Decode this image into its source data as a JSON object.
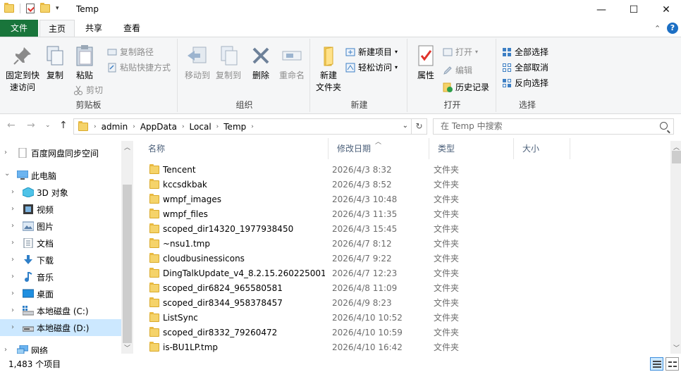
{
  "window": {
    "title": "Temp",
    "min_glyph": "—",
    "max_glyph": "☐",
    "close_glyph": "✕"
  },
  "tabs": {
    "file": "文件",
    "home": "主页",
    "share": "共享",
    "view": "查看"
  },
  "ribbon": {
    "clipboard": {
      "label": "剪贴板",
      "pin": "固定到快\n速访问",
      "copy": "复制",
      "paste": "粘贴",
      "copy_path": "复制路径",
      "paste_shortcut": "粘贴快捷方式",
      "cut": "剪切"
    },
    "organize": {
      "label": "组织",
      "move_to": "移动到",
      "copy_to": "复制到",
      "delete": "删除",
      "rename": "重命名"
    },
    "new": {
      "label": "新建",
      "new_folder": "新建\n文件夹",
      "new_item": "新建项目",
      "easy_access": "轻松访问"
    },
    "open": {
      "label": "打开",
      "properties": "属性",
      "open": "打开",
      "edit": "编辑",
      "history": "历史记录"
    },
    "select": {
      "label": "选择",
      "select_all": "全部选择",
      "select_none": "全部取消",
      "invert": "反向选择"
    }
  },
  "address": {
    "crumbs": [
      "admin",
      "AppData",
      "Local",
      "Temp"
    ],
    "search_placeholder": "在 Temp 中搜索"
  },
  "nav": {
    "items": [
      {
        "label": "百度网盘同步空间",
        "icon": "document-icon"
      },
      {
        "label": "此电脑",
        "icon": "computer-icon"
      },
      {
        "label": "3D 对象",
        "icon": "cube-icon"
      },
      {
        "label": "视频",
        "icon": "film-icon"
      },
      {
        "label": "图片",
        "icon": "picture-icon"
      },
      {
        "label": "文档",
        "icon": "document-icon"
      },
      {
        "label": "下载",
        "icon": "download-arrow-icon"
      },
      {
        "label": "音乐",
        "icon": "music-note-icon"
      },
      {
        "label": "桌面",
        "icon": "desktop-icon"
      },
      {
        "label": "本地磁盘 (C:)",
        "icon": "drive-icon"
      },
      {
        "label": "本地磁盘 (D:)",
        "icon": "drive-icon"
      },
      {
        "label": "网络",
        "icon": "network-icon"
      }
    ]
  },
  "columns": {
    "name": "名称",
    "date": "修改日期",
    "type": "类型",
    "size": "大小"
  },
  "files": [
    {
      "name": "Tencent",
      "date": "2026/4/3 8:32",
      "type": "文件夹"
    },
    {
      "name": "kccsdkbak",
      "date": "2026/4/3 8:52",
      "type": "文件夹"
    },
    {
      "name": "wmpf_images",
      "date": "2026/4/3 10:48",
      "type": "文件夹"
    },
    {
      "name": "wmpf_files",
      "date": "2026/4/3 11:35",
      "type": "文件夹"
    },
    {
      "name": "scoped_dir14320_1977938450",
      "date": "2026/4/3 15:45",
      "type": "文件夹"
    },
    {
      "name": "~nsu1.tmp",
      "date": "2026/4/7 8:12",
      "type": "文件夹"
    },
    {
      "name": "cloudbusinessicons",
      "date": "2026/4/7 9:22",
      "type": "文件夹"
    },
    {
      "name": "DingTalkUpdate_v4_8.2.15.260225001...",
      "date": "2026/4/7 12:23",
      "type": "文件夹"
    },
    {
      "name": "scoped_dir6824_965580581",
      "date": "2026/4/8 11:09",
      "type": "文件夹"
    },
    {
      "name": "scoped_dir8344_958378457",
      "date": "2026/4/9 8:23",
      "type": "文件夹"
    },
    {
      "name": "ListSync",
      "date": "2026/4/10 10:52",
      "type": "文件夹"
    },
    {
      "name": "scoped_dir8332_79260472",
      "date": "2026/4/10 10:59",
      "type": "文件夹"
    },
    {
      "name": "is-BU1LP.tmp",
      "date": "2026/4/10 16:42",
      "type": "文件夹"
    }
  ],
  "status": {
    "count": "1,483 个项目"
  },
  "colors": {
    "file_tab": "#19753b",
    "selection": "#cce8ff",
    "folder": "#f5d36a"
  }
}
